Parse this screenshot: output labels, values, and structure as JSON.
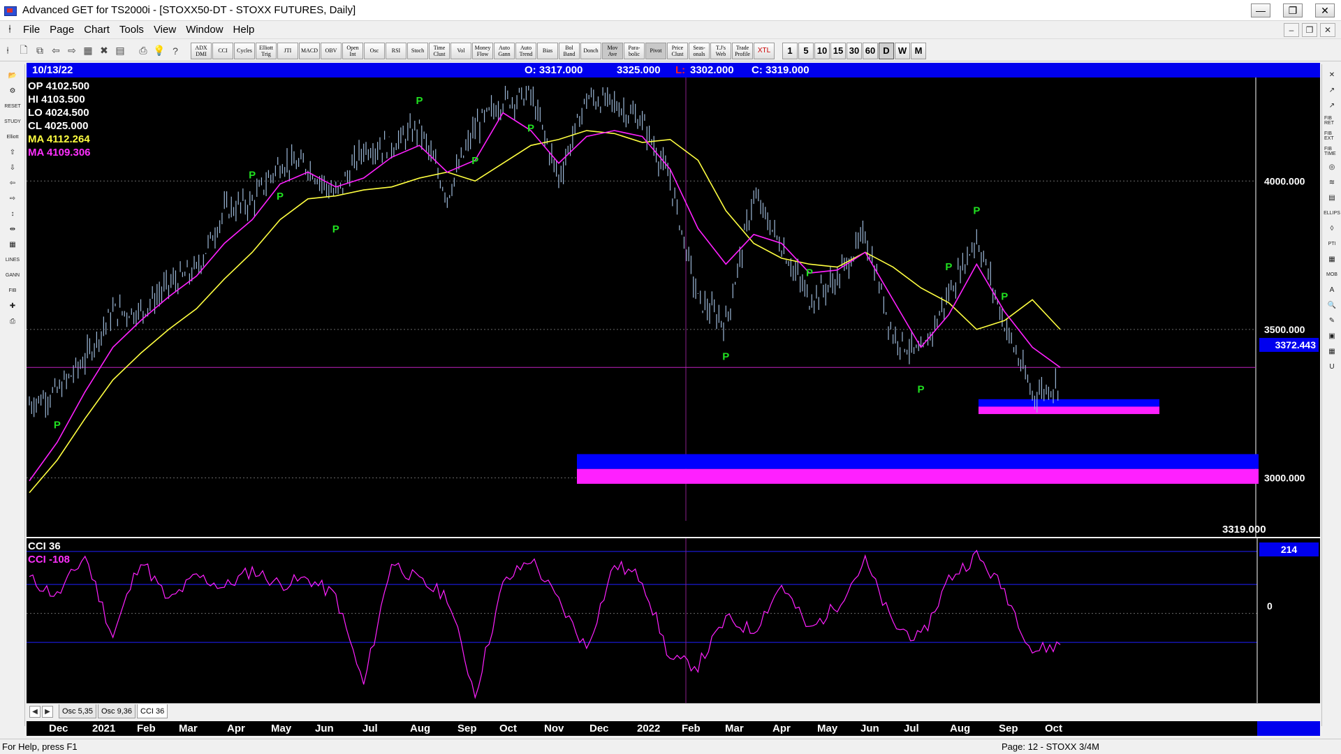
{
  "window": {
    "title": "Advanced GET for TS2000i - [STOXX50-DT - STOXX FUTURES, Daily]",
    "controls": [
      "—",
      "❐",
      "✕"
    ]
  },
  "menu": {
    "items": [
      "File",
      "Page",
      "Chart",
      "Tools",
      "View",
      "Window",
      "Help"
    ],
    "mdi_controls": [
      "–",
      "❐",
      "✕"
    ]
  },
  "toolbar": {
    "studies": [
      "ADX\nDMI",
      "CCI",
      "Cycles",
      "Elliott\nTrig",
      "JTI",
      "MACD",
      "OBV",
      "Open\nInt",
      "Osc",
      "RSI",
      "Stoch",
      "Time\nClust",
      "Vol",
      "Money\nFlow",
      "Auto\nGann",
      "Auto\nTrend",
      "Bias",
      "Bol\nBand",
      "Donch",
      "Mov\nAve",
      "Para-\nbolic",
      "Pivot",
      "Price\nClust",
      "Seas-\nonals",
      "T.J's\nWeb",
      "Trade\nProfile",
      "XTL"
    ],
    "timeframes": [
      "1",
      "5",
      "10",
      "15",
      "30",
      "60",
      "D",
      "W",
      "M"
    ],
    "active_timeframe": "D"
  },
  "left_tools": [
    "📂",
    "⚙",
    "RESET",
    "STUDY",
    "Elliott",
    "⇧",
    "⇩",
    "⇦",
    "⇨",
    "↕",
    "⇹",
    "▦",
    "LINES",
    "GANN",
    "FIB",
    "✚",
    "⎙"
  ],
  "right_tools": [
    "✕",
    "↗",
    "↗",
    "FIB RET",
    "FIB EXT",
    "FIB TIME",
    "◎",
    "≋",
    "▤",
    "ELLIPS",
    "◊",
    "PTI",
    "▦",
    "MOB",
    "A",
    "🔍",
    "✎",
    "▣",
    "▦",
    "U"
  ],
  "chart_header": {
    "date": "10/13/22",
    "open": "O: 3317.000",
    "high": "3325.000",
    "low_label": "L:",
    "low": "3302.000",
    "close": "C: 3319.000"
  },
  "info": {
    "op": "OP  4102.500",
    "hi": "HI   4103.500",
    "lo": "LO  4024.500",
    "cl": "CL  4025.000",
    "ma1": "MA  4112.264",
    "ma2": "MA  4109.306"
  },
  "price_axis": {
    "labels": [
      "4000.000",
      "3500.000",
      "3000.000"
    ],
    "current_tag": "3372.443",
    "last_price": "3319.000"
  },
  "cci_panel": {
    "title": "CCI 36",
    "value_label": "CCI  -108",
    "top_tag": "214",
    "zero_label": "0"
  },
  "tabs": {
    "items": [
      "Osc 5,35",
      "Osc 9,36",
      "CCI 36"
    ],
    "active": "CCI 36",
    "arrow_left": "◀",
    "arrow_right": "▶"
  },
  "time_axis": {
    "months": [
      "Dec",
      "2021",
      "Feb",
      "Mar",
      "Apr",
      "May",
      "Jun",
      "Jul",
      "Aug",
      "Sep",
      "Oct",
      "Nov",
      "Dec",
      "2022",
      "Feb",
      "Mar",
      "Apr",
      "May",
      "Jun",
      "Jul",
      "Aug",
      "Sep",
      "Oct"
    ]
  },
  "pivots": [
    "P",
    "P",
    "P",
    "P",
    "P",
    "P",
    "P",
    "P",
    "P",
    "P",
    "P",
    "P",
    "P",
    "P",
    "P"
  ],
  "statusbar": {
    "left": "For Help, press F1",
    "right": "Page: 12 - STOXX 3/4M"
  },
  "colors": {
    "price_bars": "#9cb8d8",
    "ma_fast": "#ff20ff",
    "ma_slow": "#ffff40",
    "pivot": "#20e020",
    "zone_blue": "#0000ff",
    "zone_magenta": "#ff20ff",
    "header_blue": "#0000ee"
  },
  "chart_data": [
    {
      "type": "line",
      "title": "STOXX50-DT - STOXX FUTURES, Daily",
      "price_range": [
        2820,
        4330
      ],
      "x": [
        "2020-11-25",
        "2020-12-15",
        "2021-01-05",
        "2021-01-28",
        "2021-02-18",
        "2021-03-10",
        "2021-03-31",
        "2021-04-20",
        "2021-05-10",
        "2021-06-01",
        "2021-06-22",
        "2021-07-12",
        "2021-07-30",
        "2021-08-18",
        "2021-09-06",
        "2021-09-24",
        "2021-10-12",
        "2021-10-29",
        "2021-11-17",
        "2021-12-01",
        "2021-12-17",
        "2022-01-05",
        "2022-01-24",
        "2022-02-10",
        "2022-02-25",
        "2022-03-07",
        "2022-03-25",
        "2022-04-13",
        "2022-05-03",
        "2022-05-20",
        "2022-06-08",
        "2022-06-30",
        "2022-07-15",
        "2022-08-01",
        "2022-08-17",
        "2022-09-05",
        "2022-09-23",
        "2022-10-13"
      ],
      "series": [
        {
          "name": "Price",
          "values": [
            3250,
            3290,
            3400,
            3560,
            3560,
            3650,
            3700,
            3900,
            3930,
            4060,
            4050,
            3950,
            4110,
            4120,
            4180,
            3950,
            4180,
            4270,
            4290,
            4010,
            4280,
            4260,
            4200,
            4000,
            3600,
            3520,
            3950,
            3780,
            3600,
            3670,
            3820,
            3480,
            3410,
            3620,
            3810,
            3520,
            3280,
            3319
          ]
        },
        {
          "name": "MA",
          "values": [
            2990,
            3120,
            3290,
            3440,
            3530,
            3610,
            3680,
            3790,
            3870,
            3990,
            4030,
            3980,
            4010,
            4080,
            4120,
            4030,
            4070,
            4230,
            4170,
            4060,
            4150,
            4170,
            4150,
            4040,
            3840,
            3720,
            3820,
            3790,
            3690,
            3700,
            3760,
            3600,
            3440,
            3550,
            3720,
            3560,
            3440,
            3372
          ]
        },
        {
          "name": "MA",
          "values": [
            2950,
            3060,
            3200,
            3330,
            3420,
            3500,
            3570,
            3670,
            3760,
            3870,
            3940,
            3950,
            3970,
            3980,
            4010,
            4030,
            4000,
            4060,
            4120,
            4140,
            4170,
            4160,
            4130,
            4140,
            4070,
            3900,
            3790,
            3740,
            3720,
            3710,
            3760,
            3710,
            3640,
            3590,
            3500,
            3530,
            3600,
            3500
          ]
        }
      ],
      "target_zones": [
        {
          "low": 2980,
          "high": 3080
        },
        {
          "low": 3215,
          "high": 3265
        }
      ]
    },
    {
      "type": "line",
      "title": "CCI 36",
      "ylim": [
        -300,
        250
      ],
      "levels": [
        214,
        100,
        0,
        -100
      ],
      "series": [
        {
          "name": "CCI",
          "values": [
            120,
            60,
            200,
            -80,
            190,
            40,
            130,
            90,
            150,
            100,
            120,
            60,
            -250,
            180,
            110,
            60,
            -280,
            100,
            190,
            40,
            -120,
            170,
            120,
            -160,
            -180,
            -20,
            -60,
            100,
            -60,
            30,
            180,
            -40,
            -90,
            120,
            200,
            80,
            -130,
            -108
          ]
        }
      ]
    }
  ]
}
